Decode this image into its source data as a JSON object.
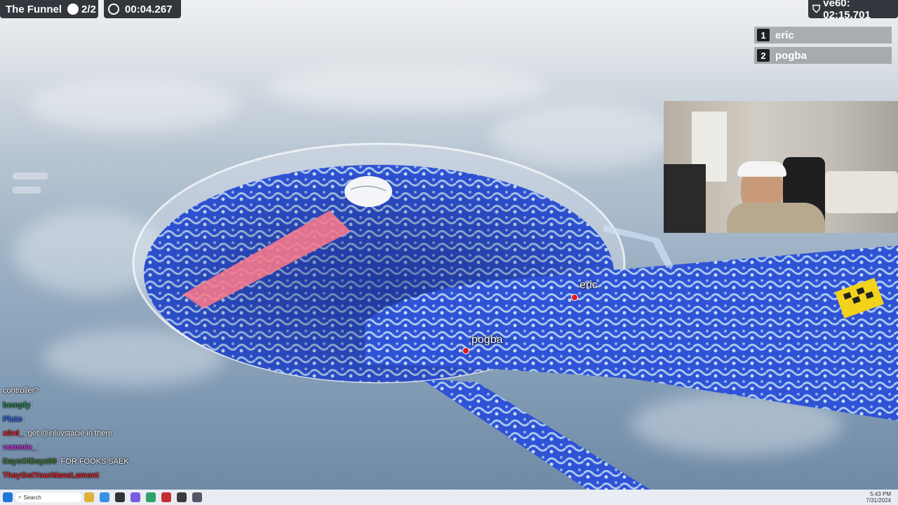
{
  "hud": {
    "level_name": "The Funnel",
    "round": "2/2",
    "timer": "00:04.267",
    "best": "ve60: 02:15.701"
  },
  "leaderboard": [
    {
      "rank": "1",
      "name": "eric"
    },
    {
      "rank": "2",
      "name": "pogba"
    }
  ],
  "markers": {
    "eric": "eric",
    "pogba": "pogba"
  },
  "chat": [
    {
      "user": "",
      "text": "controller?",
      "color": "#ffffff"
    },
    {
      "user": "bempfy",
      "text": ":",
      "color": "#2e8b57"
    },
    {
      "user": "Pluto",
      "text": ":",
      "color": "#3a6cf0"
    },
    {
      "user": "x0rd_",
      "text": ":  get @inluvstacie in there",
      "color": "#e0262b"
    },
    {
      "user": "vommie_",
      "text": ":",
      "color": "#c83ce0"
    },
    {
      "user": "DaysOfDayz90",
      "text": ":  FOR FOOKS SAEK",
      "color": "#4a7c3a"
    },
    {
      "user": "TheyGotYourManeLamont",
      "text": ":",
      "color": "#e0262b"
    }
  ],
  "taskbar": {
    "search_placeholder": "Search",
    "time": "5:43 PM",
    "date": "7/31/2024"
  },
  "colors": {
    "hud_bg": "#191c22",
    "track_blue": "#2f52d6",
    "marble_red": "#e01a1a",
    "logo_pink": "#ff7a8a"
  }
}
